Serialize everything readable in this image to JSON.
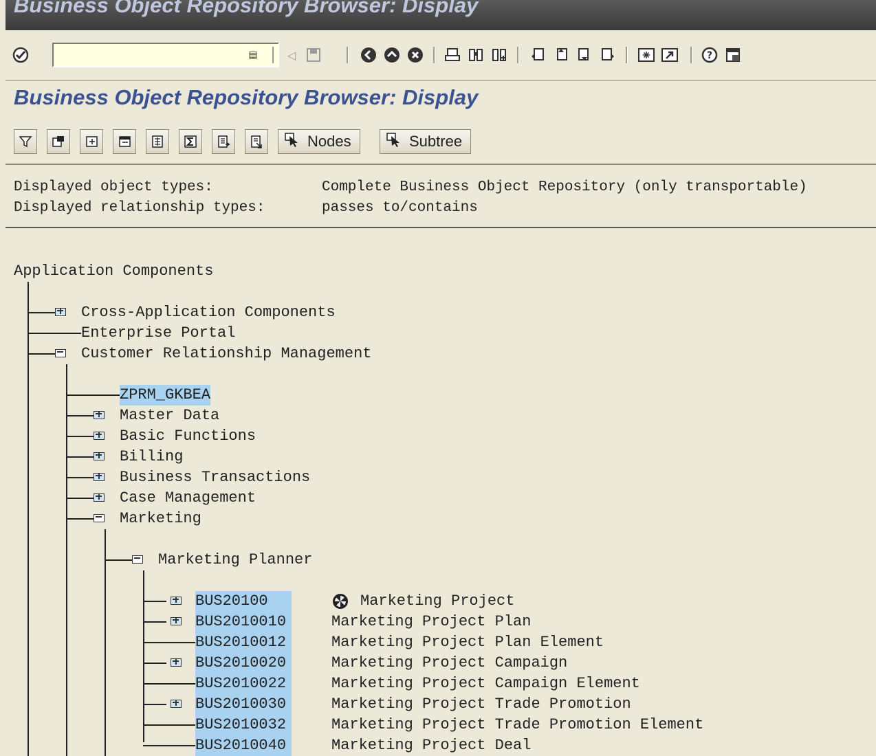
{
  "window": {
    "title": "Business Object Repository Browser: Display"
  },
  "system_toolbar": {
    "icons": [
      "enter-icon",
      "command-field-dropdown-icon",
      "back-arrow-icon",
      "save-icon",
      "back-icon",
      "exit-icon",
      "cancel-icon",
      "print-icon",
      "find-icon",
      "find-next-icon",
      "first-page-icon",
      "previous-page-icon",
      "next-page-icon",
      "last-page-icon",
      "create-session-icon",
      "shortcut-icon",
      "help-icon",
      "customize-layout-icon"
    ],
    "command_value": ""
  },
  "screen_title": "Business Object Repository Browser: Display",
  "app_toolbar": {
    "icons": [
      "filter-icon",
      "settings-icon",
      "expand-icon",
      "collapse-icon",
      "details-icon",
      "sum-icon",
      "export-icon",
      "export-list-icon"
    ],
    "nodes_label": "Nodes",
    "subtree_label": "Subtree"
  },
  "header": {
    "object_types_label": "Displayed object types:",
    "object_types_value": "Complete Business Object Repository (only transportable)",
    "relationship_types_label": "Displayed relationship types:",
    "relationship_types_value": "passes to/contains"
  },
  "tree": {
    "root": "Application Components",
    "level1": [
      "Cross-Application Components",
      "Enterprise Portal",
      "Customer Relationship Management"
    ],
    "level2": [
      "ZPRM_GKBEA",
      "Master Data",
      "Basic Functions",
      "Billing",
      "Business Transactions",
      "Case Management",
      "Marketing"
    ],
    "level3": [
      "Marketing Planner"
    ],
    "objects": [
      {
        "id": "BUS20100",
        "desc": "Marketing Project"
      },
      {
        "id": "BUS2010010",
        "desc": "Marketing Project Plan"
      },
      {
        "id": "BUS2010012",
        "desc": "Marketing Project Plan Element"
      },
      {
        "id": "BUS2010020",
        "desc": "Marketing Project Campaign"
      },
      {
        "id": "BUS2010022",
        "desc": "Marketing Project Campaign Element"
      },
      {
        "id": "BUS2010030",
        "desc": "Marketing Project Trade Promotion"
      },
      {
        "id": "BUS2010032",
        "desc": "Marketing Project Trade Promotion Element"
      },
      {
        "id": "BUS2010040",
        "desc": "Marketing Project Deal"
      }
    ]
  }
}
